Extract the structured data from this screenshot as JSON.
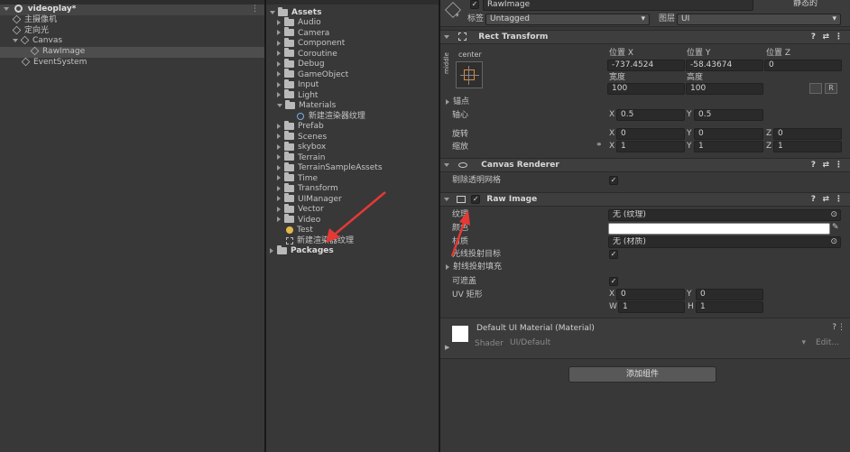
{
  "hierarchy": {
    "scene_name": "videoplay*",
    "items": [
      {
        "label": "主摄像机",
        "indent": 1
      },
      {
        "label": "定向光",
        "indent": 1
      },
      {
        "label": "Canvas",
        "indent": 1
      },
      {
        "label": "RawImage",
        "indent": 2
      },
      {
        "label": "EventSystem",
        "indent": 1
      }
    ]
  },
  "project": {
    "root": "Assets",
    "folders": [
      "Audio",
      "Camera",
      "Component",
      "Coroutine",
      "Debug",
      "GameObject",
      "Input",
      "Light",
      "Materials",
      "Prefab",
      "Scenes",
      "skybox",
      "Terrain",
      "TerrainSampleAssets",
      "Time",
      "Transform",
      "UIManager",
      "Vector",
      "Video"
    ],
    "material_child": "新建渲染器纹理",
    "test_script": "Test",
    "render_texture": "新建渲染器纹理",
    "packages": "Packages"
  },
  "inspector": {
    "object_name": "RawImage",
    "static_label": "静态的",
    "tag_label": "标签",
    "tag_value": "Untagged",
    "layer_label": "图层",
    "layer_value": "UI",
    "rect_transform": {
      "title": "Rect Transform",
      "anchor_h": "center",
      "anchor_v": "middle",
      "pos_x_label": "位置 X",
      "pos_y_label": "位置 Y",
      "pos_z_label": "位置 Z",
      "pos_x": "-737.4524",
      "pos_y": "-58.43674",
      "pos_z": "0",
      "width_label": "宽度",
      "height_label": "高度",
      "width": "100",
      "height": "100",
      "anchors_label": "锚点",
      "pivot_label": "轴心",
      "pivot_x": "0.5",
      "pivot_y": "0.5",
      "rotation_label": "旋转",
      "rot_x": "0",
      "rot_y": "0",
      "rot_z": "0",
      "scale_label": "缩放",
      "scale_x": "1",
      "scale_y": "1",
      "scale_z": "1",
      "x": "X",
      "y": "Y",
      "z": "Z"
    },
    "canvas_renderer": {
      "title": "Canvas Renderer",
      "cull_label": "剔除透明网格"
    },
    "raw_image": {
      "title": "Raw Image",
      "texture_label": "纹理",
      "texture_value": "无 (纹理)",
      "color_label": "颜色",
      "material_label": "材质",
      "material_value": "无 (材质)",
      "raycast_label": "光线投射目标",
      "raycast_padding_label": "射线投射填充",
      "maskable_label": "可遮盖",
      "uv_label": "UV 矩形",
      "uv_x": "0",
      "uv_y": "0",
      "uv_w": "1",
      "uv_h": "1",
      "w": "W",
      "h": "H"
    },
    "material": {
      "title": "Default UI Material (Material)",
      "shader_label": "Shader",
      "shader_value": "UI/Default",
      "edit_label": "Edit..."
    },
    "add_component": "添加组件"
  }
}
